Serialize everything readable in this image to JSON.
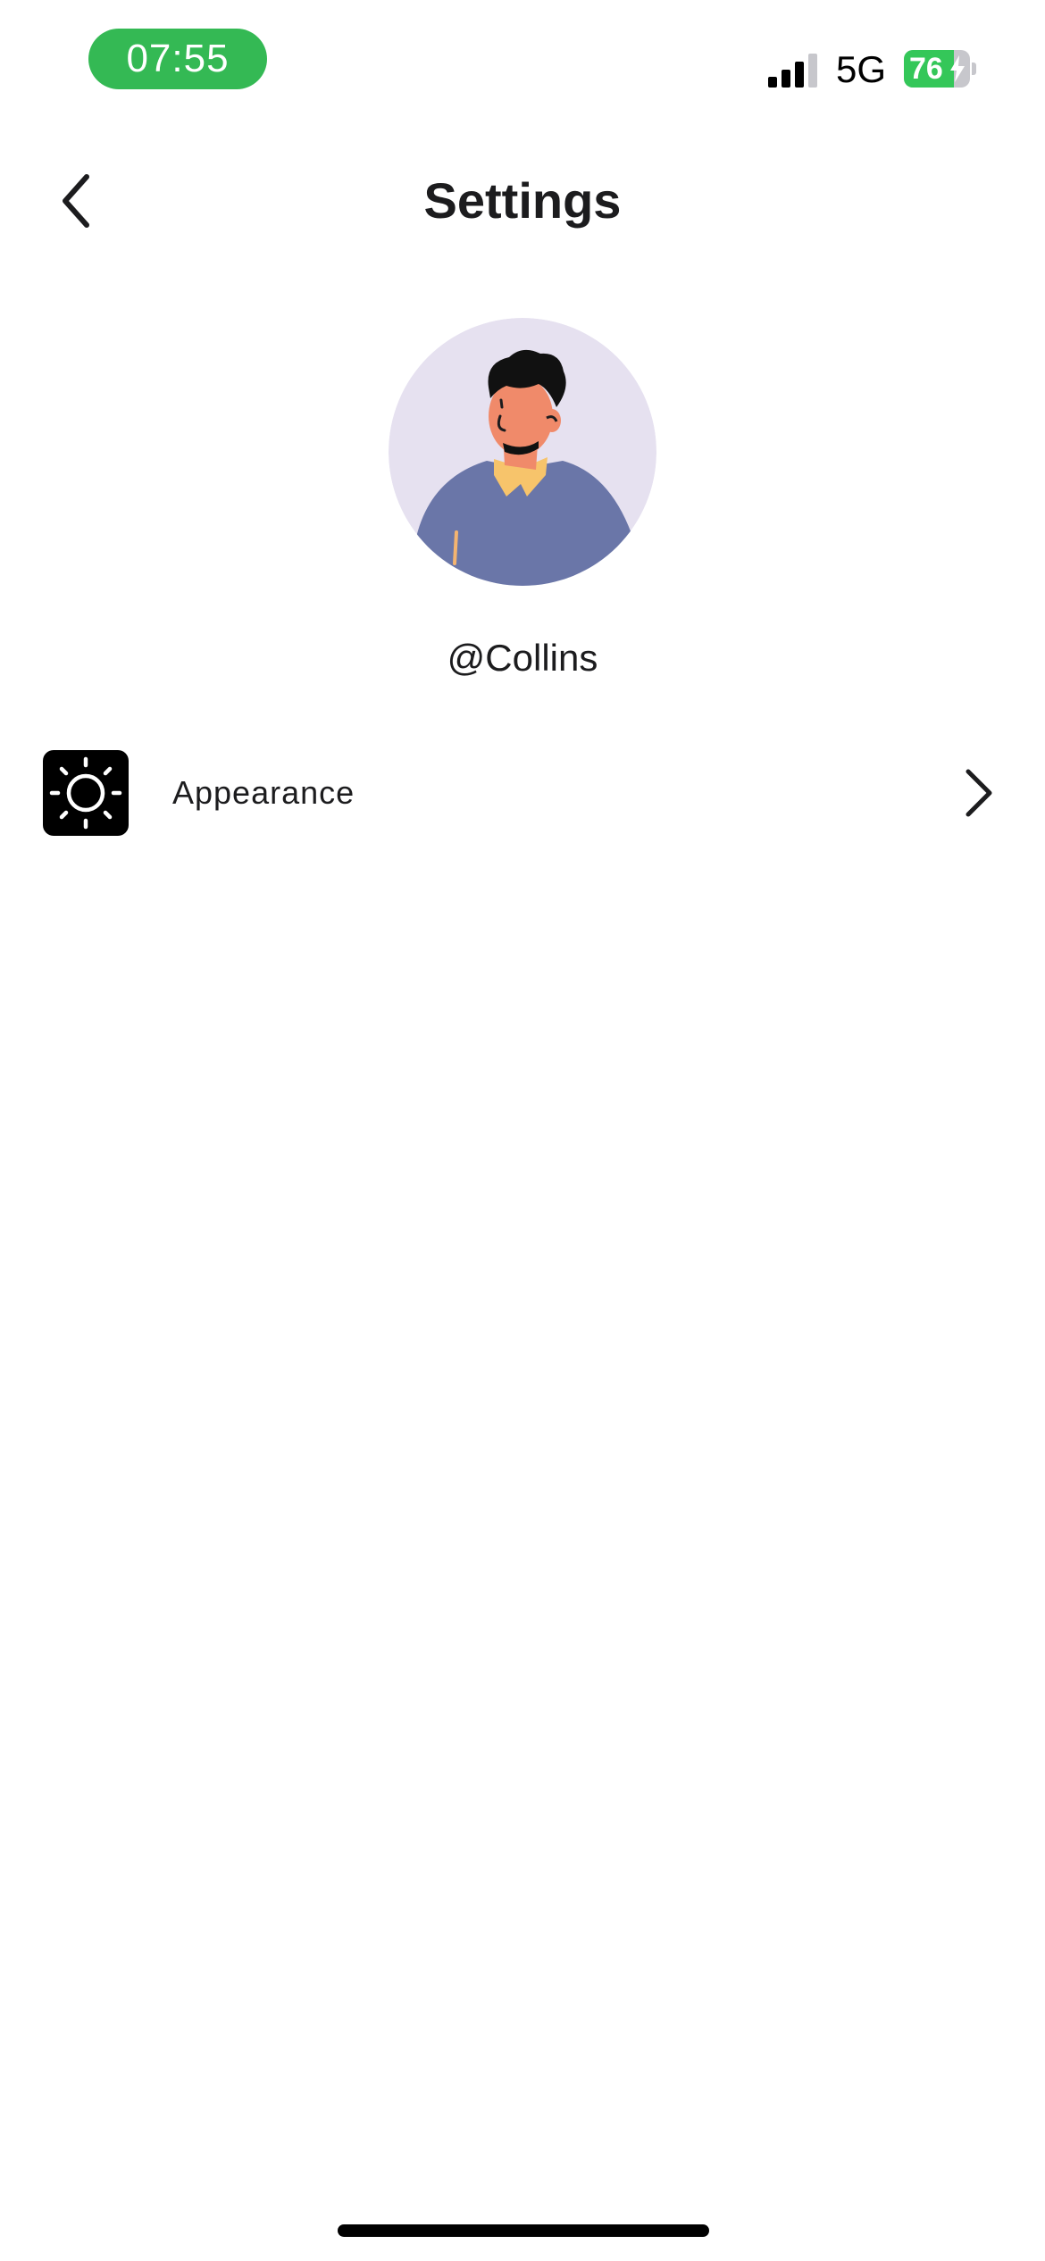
{
  "status_bar": {
    "time": "07:55",
    "time_pill_color": "#34b954",
    "network": "5G",
    "signal_icon": "cellular-signal-icon",
    "signal_bars_active": 3,
    "signal_bars_total": 4,
    "battery_level": "76",
    "battery_fraction": 0.76,
    "battery_charging": true,
    "battery_color": "#34c759"
  },
  "nav": {
    "back_icon": "chevron-left-icon",
    "title": "Settings"
  },
  "profile": {
    "avatar": "person-illustration-avatar",
    "avatar_background": "#e6e1f0",
    "username": "@Collins"
  },
  "settings": {
    "items": [
      {
        "label": "Appearance",
        "icon": "sun-icon",
        "icon_background": "#000000",
        "chevron_icon": "chevron-right-icon"
      }
    ]
  }
}
